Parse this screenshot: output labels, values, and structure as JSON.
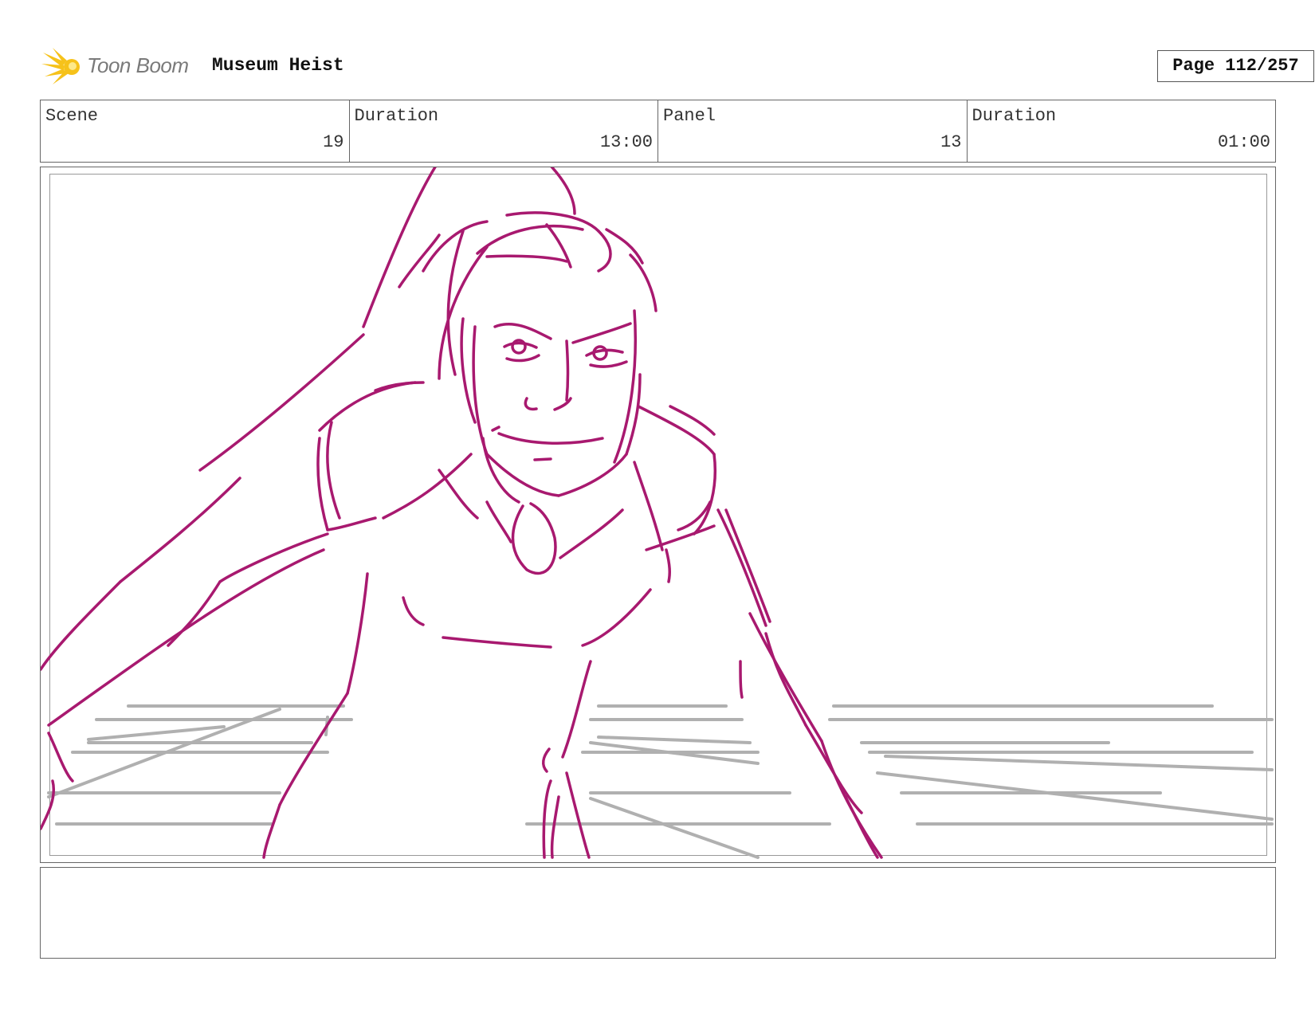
{
  "header": {
    "brand": "Toon Boom",
    "project_title": "Museum Heist",
    "page_label": "Page 112/257"
  },
  "info": {
    "scene_label": "Scene",
    "scene_value": "19",
    "scene_duration_label": "Duration",
    "scene_duration_value": "13:00",
    "panel_label": "Panel",
    "panel_value": "13",
    "panel_duration_label": "Duration",
    "panel_duration_value": "01:00"
  },
  "colors": {
    "sketch_line": "#a8196f",
    "background_line": "#b0b0b0",
    "logo_yellow": "#f6c21a"
  },
  "icons": {
    "logo": "sunburst-comet-icon"
  }
}
